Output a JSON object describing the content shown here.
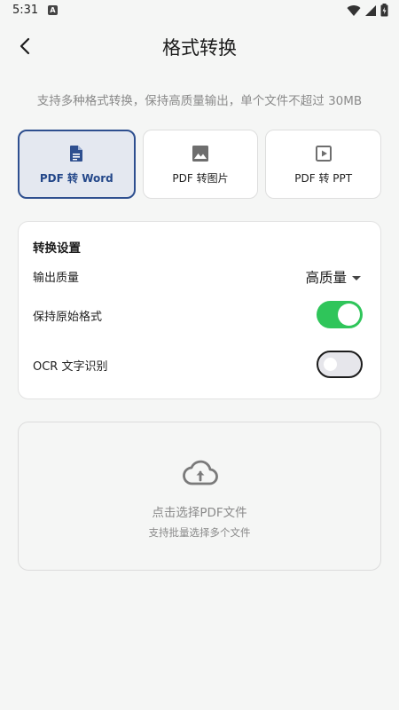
{
  "status": {
    "time": "5:31",
    "notif": "A"
  },
  "header": {
    "title": "格式转换"
  },
  "subtitle": "支持多种格式转换，保持高质量输出，单个文件不超过 30MB",
  "modes": [
    {
      "label": "PDF 转 Word",
      "icon": "document-icon",
      "active": true
    },
    {
      "label": "PDF 转图片",
      "icon": "image-icon",
      "active": false
    },
    {
      "label": "PDF 转 PPT",
      "icon": "slideshow-icon",
      "active": false
    }
  ],
  "settings": {
    "title": "转换设置",
    "quality_label": "输出质量",
    "quality_value": "高质量",
    "keep_format_label": "保持原始格式",
    "keep_format_on": true,
    "ocr_label": "OCR 文字识别",
    "ocr_on": false
  },
  "upload": {
    "title": "点击选择PDF文件",
    "hint": "支持批量选择多个文件"
  },
  "colors": {
    "accent": "#2e4f8f",
    "toggle_on": "#2fc55a",
    "active_bg": "#e4e8f0"
  }
}
